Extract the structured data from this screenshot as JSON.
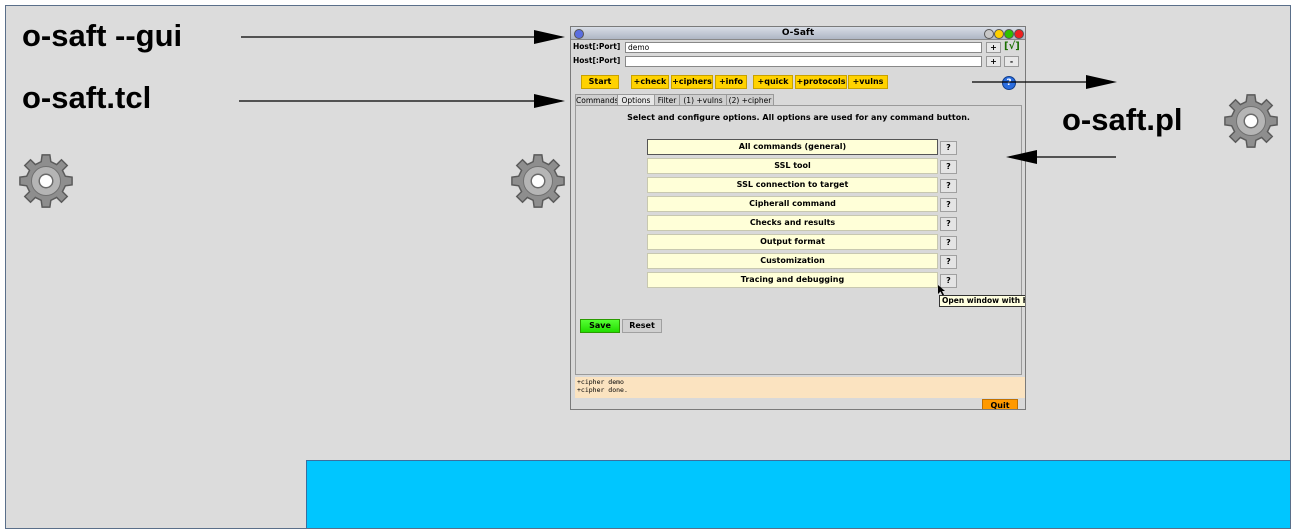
{
  "labels": {
    "gui_command": "o-saft --gui",
    "tcl_script": "o-saft.tcl",
    "perl_script": "o-saft.pl"
  },
  "window": {
    "title": "O-Saft",
    "host_label_1": "Host[:Port]",
    "host_value_1": "demo",
    "host_label_2": "Host[:Port]",
    "host_value_2": "",
    "add_label": "+",
    "remove_label": "-",
    "check_mark": "[√]",
    "help_label": "?",
    "command_buttons": [
      "Start",
      "+check",
      "+ciphers",
      "+info",
      "+quick",
      "+protocols",
      "+vulns"
    ],
    "tabs": [
      "Commands",
      "Options",
      "Filter",
      "(1) +vulns",
      "(2) +cipher"
    ],
    "active_tab": "Options",
    "intro": "Select and configure options. All options are used for any command button.",
    "option_groups": [
      "All commands (general)",
      "SSL tool",
      "SSL connection to target",
      "Cipherall command",
      "Checks and results",
      "Output format",
      "Customization",
      "Tracing and debugging"
    ],
    "option_help_label": "?",
    "tooltip": "Open window with he",
    "save_label": "Save",
    "reset_label": "Reset",
    "log_lines": [
      "+cipher demo",
      "+cipher done."
    ],
    "quit_label": "Quit"
  },
  "colors": {
    "background": "#dcdcdc",
    "accent_box": "#00c6ff",
    "command_button": "#ffd200",
    "save_button": "#33ee00",
    "quit_button": "#ff9900",
    "log_background": "#fbe3c0"
  }
}
